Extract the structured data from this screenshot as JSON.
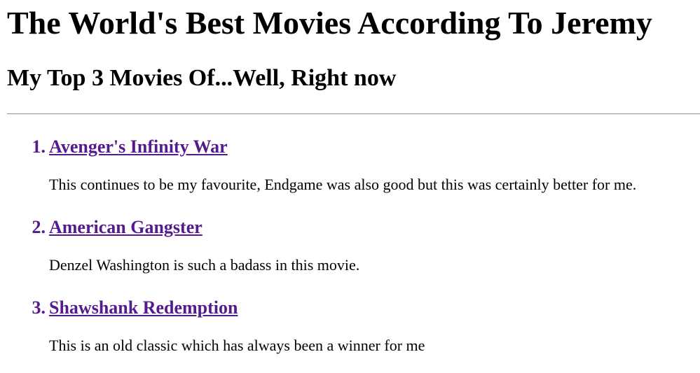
{
  "page": {
    "title": "The World's Best Movies According To Jeremy",
    "subtitle": "My Top 3 Movies Of...Well, Right now"
  },
  "movies": [
    {
      "number": "1.",
      "title": "Avenger's Infinity War",
      "description": "This continues to be my favourite, Endgame was also good but this was certainly better for me."
    },
    {
      "number": "2.",
      "title": "American Gangster",
      "description": "Denzel Washington is such a badass in this movie."
    },
    {
      "number": "3.",
      "title": "Shawshank Redemption",
      "description": "This is an old classic which has always been a winner for me"
    }
  ],
  "colors": {
    "link_visited": "#551a8b",
    "text": "#000000",
    "divider": "#9a9a9a"
  }
}
